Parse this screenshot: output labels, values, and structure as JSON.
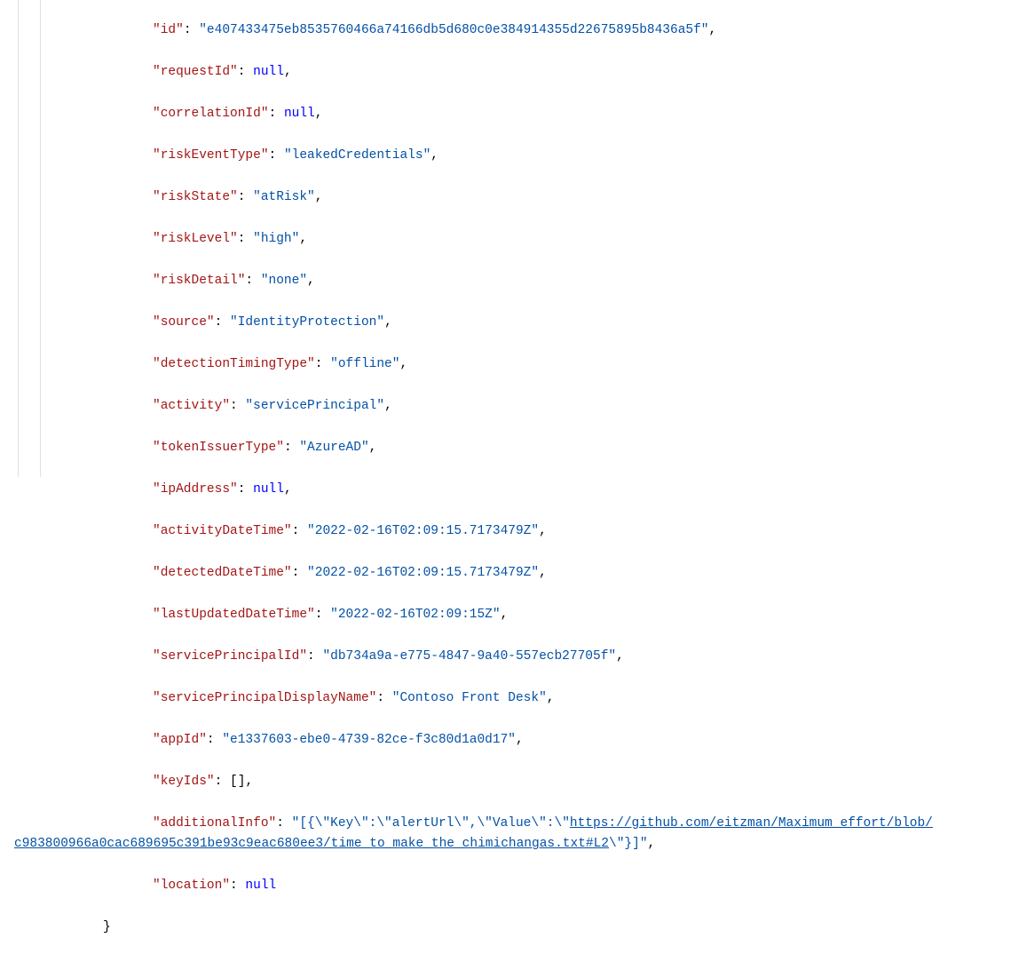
{
  "fields": {
    "id": {
      "key": "\"id\"",
      "value": "\"e407433475eb8535760466a74166db5d680c0e384914355d22675895b8436a5f\"",
      "type": "str"
    },
    "requestId": {
      "key": "\"requestId\"",
      "value": "null",
      "type": "null"
    },
    "correlationId": {
      "key": "\"correlationId\"",
      "value": "null",
      "type": "null"
    },
    "riskEventType": {
      "key": "\"riskEventType\"",
      "value": "\"leakedCredentials\"",
      "type": "str"
    },
    "riskState": {
      "key": "\"riskState\"",
      "value": "\"atRisk\"",
      "type": "str"
    },
    "riskLevel": {
      "key": "\"riskLevel\"",
      "value": "\"high\"",
      "type": "str"
    },
    "riskDetail": {
      "key": "\"riskDetail\"",
      "value": "\"none\"",
      "type": "str"
    },
    "source": {
      "key": "\"source\"",
      "value": "\"IdentityProtection\"",
      "type": "str"
    },
    "detectionTimingType": {
      "key": "\"detectionTimingType\"",
      "value": "\"offline\"",
      "type": "str"
    },
    "activity": {
      "key": "\"activity\"",
      "value": "\"servicePrincipal\"",
      "type": "str"
    },
    "tokenIssuerType": {
      "key": "\"tokenIssuerType\"",
      "value": "\"AzureAD\"",
      "type": "str"
    },
    "ipAddress": {
      "key": "\"ipAddress\"",
      "value": "null",
      "type": "null"
    },
    "activityDateTime": {
      "key": "\"activityDateTime\"",
      "value": "\"2022-02-16T02:09:15.7173479Z\"",
      "type": "str"
    },
    "detectedDateTime": {
      "key": "\"detectedDateTime\"",
      "value": "\"2022-02-16T02:09:15.7173479Z\"",
      "type": "str"
    },
    "lastUpdatedDateTime": {
      "key": "\"lastUpdatedDateTime\"",
      "value": "\"2022-02-16T02:09:15Z\"",
      "type": "str"
    },
    "servicePrincipalId": {
      "key": "\"servicePrincipalId\"",
      "value": "\"db734a9a-e775-4847-9a40-557ecb27705f\"",
      "type": "str"
    },
    "servicePrincipalDisplayName": {
      "key": "\"servicePrincipalDisplayName\"",
      "value": "\"Contoso Front Desk\"",
      "type": "str"
    },
    "appId": {
      "key": "\"appId\"",
      "value": "\"e1337603-ebe0-4739-82ce-f3c80d1a0d17\"",
      "type": "str"
    },
    "keyIds": {
      "key": "\"keyIds\"",
      "value": "[]",
      "type": "punct"
    },
    "location": {
      "key": "\"location\"",
      "value": "null",
      "type": "null"
    }
  },
  "additionalInfo": {
    "key": "\"additionalInfo\"",
    "prefix": "\"[{\\\"Key\\\":\\\"alertUrl\\\",\\\"Value\\\":\\\"",
    "url_part1": "https://github.com/eitzman/Maximum_effort/blob/",
    "url_part2": "c983800966a0cac689695c391be93c9eac680ee3/time_to_make_the_chimichangas.txt#L2",
    "suffix": "\\\"}]\""
  },
  "closingBrace": "}"
}
